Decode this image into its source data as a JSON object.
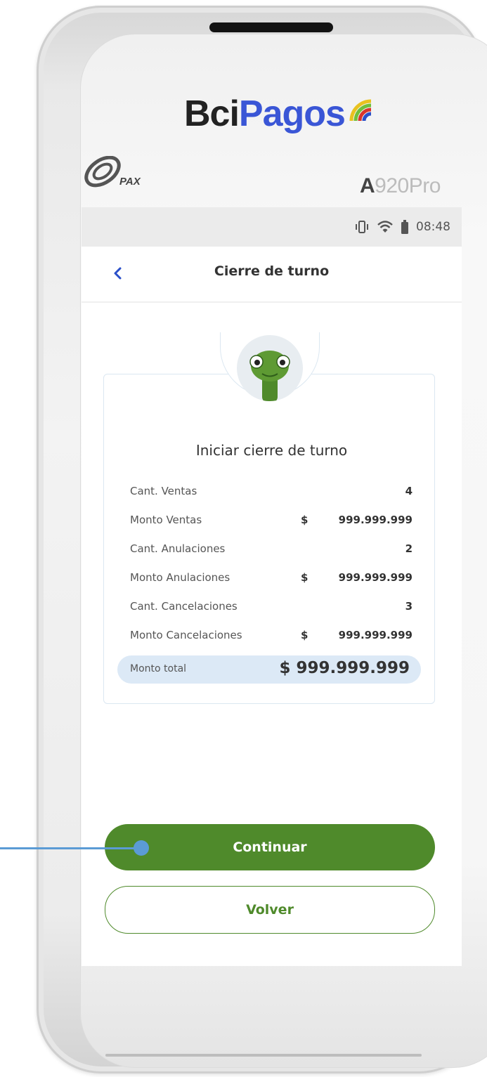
{
  "device": {
    "brand_bci": "Bci",
    "brand_pagos": "Pagos",
    "maker": "PAX",
    "model_prefix": "A",
    "model_rest": "920Pro"
  },
  "statusbar": {
    "time": "08:48",
    "icons": [
      "vibrate-icon",
      "wifi-icon",
      "battery-icon"
    ]
  },
  "header": {
    "title": "Cierre de turno",
    "back_icon": "chevron-left-icon"
  },
  "card": {
    "title": "Iniciar cierre de turno",
    "rows": [
      {
        "label": "Cant. Ventas",
        "currency": "",
        "value": "4"
      },
      {
        "label": "Monto Ventas",
        "currency": "$",
        "value": "999.999.999"
      },
      {
        "label": "Cant. Anulaciones",
        "currency": "",
        "value": "2"
      },
      {
        "label": "Monto Anulaciones",
        "currency": "$",
        "value": "999.999.999"
      },
      {
        "label": "Cant. Cancelaciones",
        "currency": "",
        "value": "3"
      },
      {
        "label": "Monto Cancelaciones",
        "currency": "$",
        "value": "999.999.999"
      }
    ],
    "total": {
      "label": "Monto total",
      "value": "$ 999.999.999"
    }
  },
  "buttons": {
    "continue_label": "Continuar",
    "back_label": "Volver"
  },
  "colors": {
    "primary_green": "#4f8a2b",
    "brand_blue": "#3a56d6",
    "highlight_blue": "#dce9f6",
    "pointer_blue": "#5b9bd5"
  }
}
